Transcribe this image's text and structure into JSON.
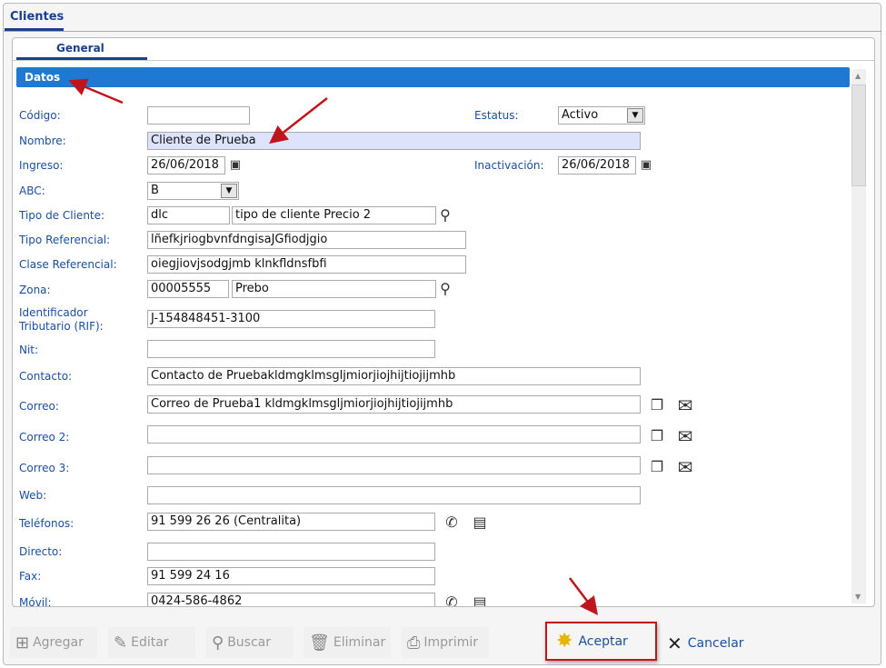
{
  "window": {
    "tab": "Clientes",
    "subtab": "General",
    "section": "Datos"
  },
  "fields": {
    "codigo": {
      "label": "Código:",
      "value": ""
    },
    "estatus": {
      "label": "Estatus:",
      "value": "Activo"
    },
    "nombre": {
      "label": "Nombre:",
      "value": "Cliente de Prueba"
    },
    "ingreso": {
      "label": "Ingreso:",
      "value": "26/06/2018"
    },
    "inactivacion": {
      "label": "Inactivación:",
      "value": "26/06/2018"
    },
    "abc": {
      "label": "ABC:",
      "value": "B"
    },
    "tipo_cliente": {
      "label": "Tipo de Cliente:",
      "code": "dlc",
      "value": "tipo de cliente Precio 2"
    },
    "tipo_referencial": {
      "label": "Tipo Referencial:",
      "value": "lñefkjriogbvnfdngisaJGfiodjgio"
    },
    "clase_referencial": {
      "label": "Clase Referencial:",
      "value": "oiegjiovjsodgjmb klnkfldnsfbfi"
    },
    "zona": {
      "label": "Zona:",
      "code": "00005555",
      "value": "Prebo"
    },
    "rif": {
      "label1": "Identificador",
      "label2": "Tributario (RIF):",
      "value": "J-154848451-3100"
    },
    "nit": {
      "label": "Nit:",
      "value": ""
    },
    "contacto": {
      "label": "Contacto:",
      "value": "Contacto de Pruebakldmgklmsgljmiorjiojhijtiojijmhb"
    },
    "correo": {
      "label": "Correo:",
      "value": "Correo de Prueba1 kldmgklmsgljmiorjiojhijtiojijmhb"
    },
    "correo2": {
      "label": "Correo 2:",
      "value": ""
    },
    "correo3": {
      "label": "Correo 3:",
      "value": ""
    },
    "web": {
      "label": "Web:",
      "value": ""
    },
    "telefonos": {
      "label": "Teléfonos:",
      "value": "91 599 26 26 (Centralita)"
    },
    "directo": {
      "label": "Directo:",
      "value": ""
    },
    "fax": {
      "label": "Fax:",
      "value": "91 599 24 16"
    },
    "movil": {
      "label": "Móvil:",
      "value": "0424-586-4862"
    }
  },
  "toolbar": {
    "agregar": "Agregar",
    "editar": "Editar",
    "buscar": "Buscar",
    "eliminar": "Eliminar",
    "imprimir": "Imprimir",
    "aceptar": "Aceptar",
    "cancelar": "Cancelar"
  },
  "colors": {
    "accent": "#1e79d4",
    "label": "#1a4fa0",
    "highlight": "#dde3fb",
    "annotation": "#c0161b"
  }
}
